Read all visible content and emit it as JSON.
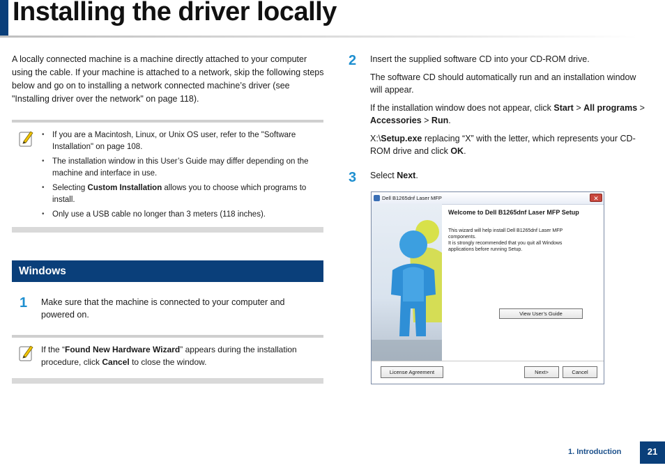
{
  "page": {
    "title": "Installing the driver locally",
    "section_footer": "1. Introduction",
    "page_number": "21"
  },
  "intro": "A locally connected machine is a machine directly attached to your computer using the cable. If your machine is attached to a network, skip the following steps below and go on to installing a network connected machine’s driver (see \"Installing driver over the network\" on page 118).",
  "note1": {
    "icon": "note-pencil-icon",
    "items": [
      "If you are a Macintosh, Linux, or Unix OS user, refer to the \"Software Installation\" on page 108.",
      "The installation window in this User’s Guide may differ depending on the machine and interface in use.",
      {
        "pre": "Selecting ",
        "bold": "Custom Installation",
        "post": " allows you to choose which programs to install."
      },
      "Only use a USB cable no longer than 3 meters (118 inches)."
    ]
  },
  "windows_section": {
    "heading": "Windows",
    "step1": {
      "num": "1",
      "text": "Make sure that the machine is connected to your computer and powered on."
    },
    "note2": {
      "pre": "If the “",
      "bold1": "Found New Hardware Wizard",
      "mid": "” appears during the installation procedure, click ",
      "bold2": "Cancel",
      "post": " to close the window."
    }
  },
  "step2": {
    "num": "2",
    "line1": "Insert the supplied software CD into your CD-ROM drive.",
    "line2": "The software CD should automatically run and an installation window will appear.",
    "line3": {
      "pre": "If the installation window does not appear, click ",
      "b1": "Start",
      "s1": " > ",
      "b2": "All programs",
      "s2": " > ",
      "b3": "Accessories",
      "s3": " > ",
      "b4": "Run",
      "post": "."
    },
    "line4": {
      "pre": " X:\\",
      "b1": "Setup.exe",
      "mid": " replacing “X” with the letter, which represents your CD-ROM drive and click ",
      "b2": "OK",
      "post": "."
    }
  },
  "step3": {
    "num": "3",
    "pre": "Select ",
    "bold": "Next",
    "post": "."
  },
  "screenshot": {
    "window_title": "Dell B1265dnf Laser MFP",
    "close": "✕",
    "welcome": "Welcome to Dell B1265dnf Laser MFP Setup",
    "body_line1": "This wizard will help install Dell B1265dnf Laser MFP components.",
    "body_line2": "It is strongly recommended that you quit all Windows applications before running Setup.",
    "view_guide_button": "View User’s Guide",
    "license_button": "License Agreement",
    "next_button": "Next>",
    "cancel_button": "Cancel"
  }
}
